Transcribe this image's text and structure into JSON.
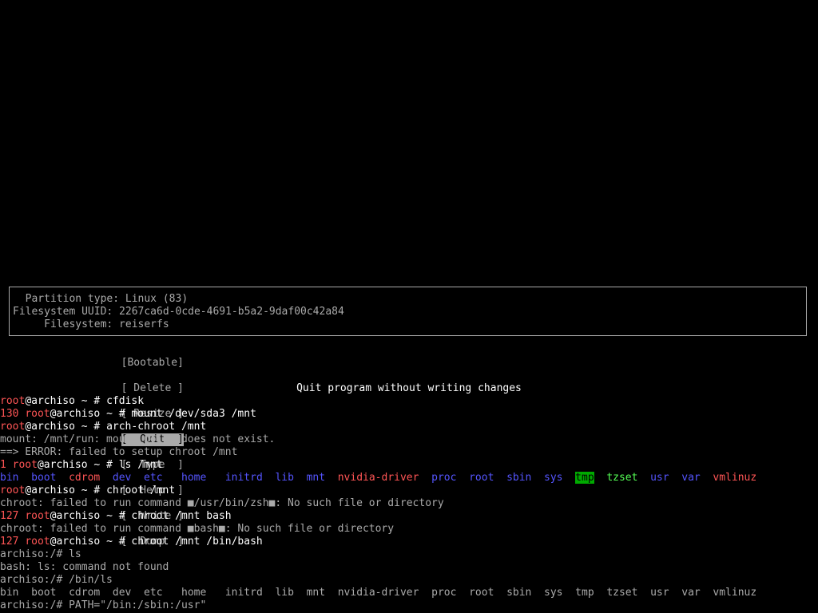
{
  "info": {
    "partition_type": "  Partition type: Linux (83)",
    "filesystem_uuid": "Filesystem UUID: 2267ca6d-0cde-4691-b5a2-9daf00c42a84",
    "filesystem": "     Filesystem: reiserfs"
  },
  "menu": {
    "items": [
      "[Bootable]",
      "[ Delete ]",
      "[ Resize ]",
      "[  Quit  ]",
      "[  Type  ]",
      "[  Help  ]",
      "[  Write ]",
      "[  Dump  ]"
    ],
    "selected_index": 3
  },
  "status": "Quit program without writing changes",
  "terminal": {
    "lines": [
      {
        "code": "",
        "user": "root",
        "host": "@archiso ~ # ",
        "cmd": "cfdisk"
      },
      {
        "code": "130 ",
        "user": "root",
        "host": "@archiso ~ # ",
        "cmd": "mount /dev/sda3 /mnt"
      },
      {
        "code": "",
        "user": "root",
        "host": "@archiso ~ # ",
        "cmd": "arch-chroot /mnt"
      },
      {
        "text": "mount: /mnt/run: mount point does not exist."
      },
      {
        "text": "==> ERROR: failed to setup chroot /mnt"
      },
      {
        "code": "1 ",
        "user": "root",
        "host": "@archiso ~ # ",
        "cmd": "ls /mnt"
      },
      {
        "ls": true,
        "colored": true
      },
      {
        "code": "",
        "user": "root",
        "host": "@archiso ~ # ",
        "cmd": "chroot /mnt"
      },
      {
        "text": "chroot: failed to run command ■/usr/bin/zsh■: No such file or directory"
      },
      {
        "code": "127 ",
        "user": "root",
        "host": "@archiso ~ # ",
        "cmd": "chroot /mnt bash"
      },
      {
        "text": "chroot: failed to run command ■bash■: No such file or directory"
      },
      {
        "code": "127 ",
        "user": "root",
        "host": "@archiso ~ # ",
        "cmd": "chroot /mnt /bin/bash"
      },
      {
        "text": "archiso:/# ls"
      },
      {
        "text": "bash: ls: command not found"
      },
      {
        "text": "archiso:/# /bin/ls"
      },
      {
        "ls": true,
        "colored": false
      },
      {
        "text": "archiso:/# PATH=\"/bin:/sbin:/usr\""
      }
    ],
    "ls_entries": [
      {
        "name": "bin",
        "color": "blue"
      },
      {
        "name": "boot",
        "color": "blue"
      },
      {
        "name": "cdrom",
        "color": "red"
      },
      {
        "name": "dev",
        "color": "blue"
      },
      {
        "name": "etc",
        "color": "blue"
      },
      {
        "name": "home",
        "color": "blue"
      },
      {
        "name": "initrd",
        "color": "blue"
      },
      {
        "name": "lib",
        "color": "blue"
      },
      {
        "name": "mnt",
        "color": "blue"
      },
      {
        "name": "nvidia-driver",
        "color": "red"
      },
      {
        "name": "proc",
        "color": "blue"
      },
      {
        "name": "root",
        "color": "blue"
      },
      {
        "name": "sbin",
        "color": "blue"
      },
      {
        "name": "sys",
        "color": "blue"
      },
      {
        "name": "tmp",
        "color": "tmp"
      },
      {
        "name": "tzset",
        "color": "green"
      },
      {
        "name": "usr",
        "color": "blue"
      },
      {
        "name": "var",
        "color": "blue"
      },
      {
        "name": "vmlinuz",
        "color": "red"
      }
    ]
  },
  "colors": {
    "background": "#000000",
    "foreground": "#aaaaaa",
    "bright": "#ffffff",
    "red": "#ff5555",
    "blue": "#5555ff",
    "green": "#55ff55",
    "highlight_bg": "#00aa00"
  }
}
